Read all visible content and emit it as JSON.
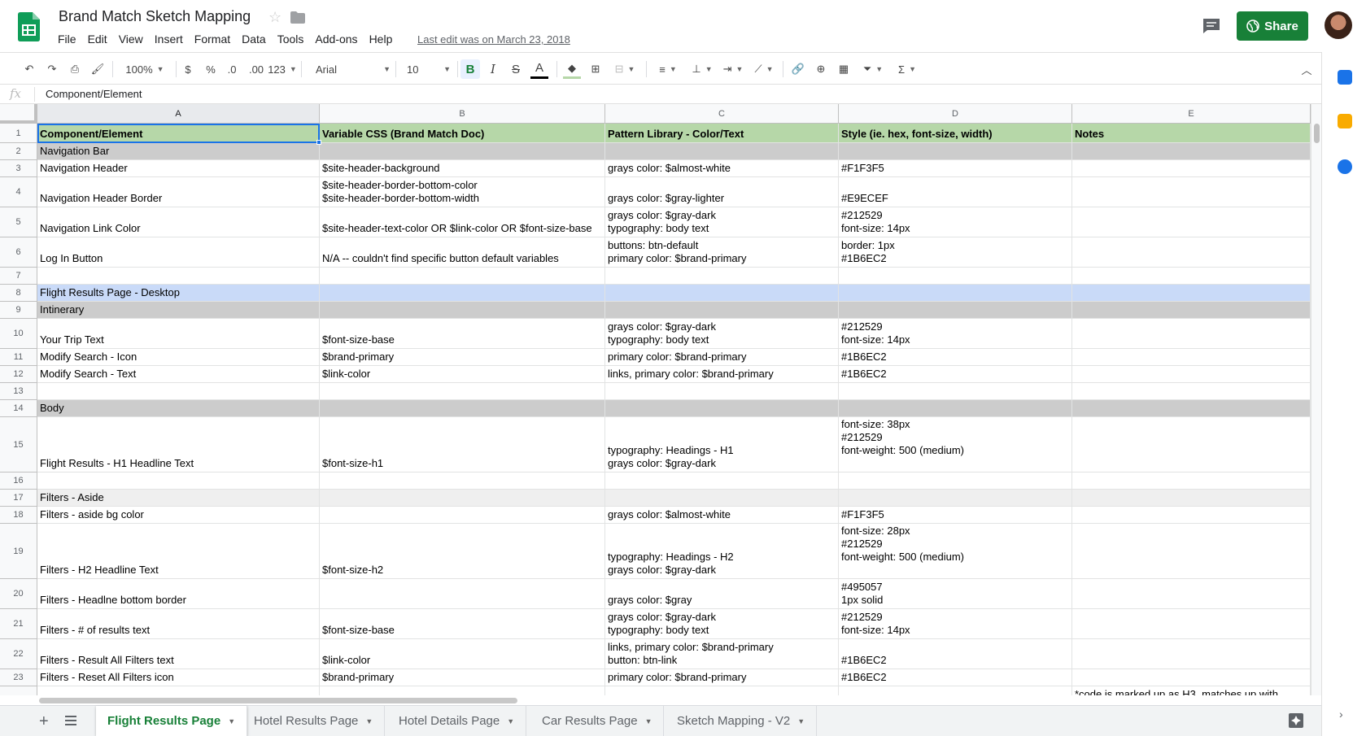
{
  "header": {
    "title": "Brand Match Sketch Mapping",
    "menus": [
      "File",
      "Edit",
      "View",
      "Insert",
      "Format",
      "Data",
      "Tools",
      "Add-ons",
      "Help"
    ],
    "last_edit": "Last edit was on March 23, 2018",
    "share_label": "Share"
  },
  "toolbar": {
    "zoom": "100%",
    "currency": "$",
    "percent": "%",
    "dec_decrease": ".0",
    "dec_increase": ".00",
    "more_formats": "123",
    "font": "Arial",
    "font_size": "10",
    "bold": "B",
    "italic": "I",
    "strike": "S",
    "text_color": "A",
    "function": "Σ"
  },
  "formula_bar": {
    "fx": "fx",
    "value": "Component/Element"
  },
  "columns": [
    "A",
    "B",
    "C",
    "D",
    "E"
  ],
  "rows": [
    {
      "num": "1",
      "style": "hdr",
      "cells": [
        [
          "Component/Element"
        ],
        [
          "Variable CSS (Brand Match Doc)"
        ],
        [
          "Pattern Library - Color/Text"
        ],
        [
          "Style (ie. hex, font-size, width)"
        ],
        [
          "Notes"
        ]
      ]
    },
    {
      "num": "2",
      "style": "gray",
      "cells": [
        [
          "Navigation Bar"
        ],
        [],
        [],
        [],
        []
      ]
    },
    {
      "num": "3",
      "style": "",
      "cells": [
        [
          "Navigation Header"
        ],
        [
          "$site-header-background"
        ],
        [
          "grays color: $almost-white"
        ],
        [
          "#F1F3F5"
        ],
        []
      ]
    },
    {
      "num": "4",
      "style": "",
      "cells": [
        [
          "Navigation Header Border"
        ],
        [
          "$site-header-border-bottom-color",
          "$site-header-border-bottom-width"
        ],
        [
          "grays color: $gray-lighter"
        ],
        [
          "#E9ECEF"
        ],
        []
      ]
    },
    {
      "num": "5",
      "style": "",
      "cells": [
        [
          "Navigation Link Color"
        ],
        [
          "$site-header-text-color OR $link-color OR $font-size-base"
        ],
        [
          "grays color: $gray-dark",
          "typography: body text"
        ],
        [
          "#212529",
          "font-size: 14px"
        ],
        []
      ]
    },
    {
      "num": "6",
      "style": "",
      "cells": [
        [
          "Log In Button"
        ],
        [
          "N/A -- couldn't find specific button default variables"
        ],
        [
          "buttons: btn-default",
          "primary color: $brand-primary"
        ],
        [
          "border: 1px",
          "#1B6EC2"
        ],
        []
      ]
    },
    {
      "num": "7",
      "style": "",
      "cells": [
        [],
        [],
        [],
        [],
        []
      ]
    },
    {
      "num": "8",
      "style": "blue",
      "cells": [
        [
          "Flight Results Page - Desktop"
        ],
        [],
        [],
        [],
        []
      ]
    },
    {
      "num": "9",
      "style": "gray",
      "cells": [
        [
          "Intinerary"
        ],
        [],
        [],
        [],
        []
      ]
    },
    {
      "num": "10",
      "style": "",
      "cells": [
        [
          "Your Trip Text"
        ],
        [
          "$font-size-base"
        ],
        [
          "grays color: $gray-dark",
          "typography: body text"
        ],
        [
          "#212529",
          "font-size: 14px"
        ],
        []
      ]
    },
    {
      "num": "11",
      "style": "",
      "cells": [
        [
          "Modify Search - Icon"
        ],
        [
          "$brand-primary"
        ],
        [
          "primary color: $brand-primary"
        ],
        [
          "#1B6EC2"
        ],
        []
      ]
    },
    {
      "num": "12",
      "style": "",
      "cells": [
        [
          "Modify Search - Text"
        ],
        [
          "$link-color"
        ],
        [
          "links, primary color: $brand-primary"
        ],
        [
          "#1B6EC2"
        ],
        []
      ]
    },
    {
      "num": "13",
      "style": "",
      "cells": [
        [],
        [],
        [],
        [],
        []
      ]
    },
    {
      "num": "14",
      "style": "gray",
      "cells": [
        [
          "Body"
        ],
        [],
        [],
        [],
        []
      ]
    },
    {
      "num": "15",
      "style": "",
      "cells": [
        [
          "Flight Results - H1 Headline Text"
        ],
        [
          "$font-size-h1"
        ],
        [
          "typography: Headings - H1",
          "grays color: $gray-dark"
        ],
        [
          "font-size: 38px",
          "#212529",
          "font-weight: 500 (medium)",
          ""
        ],
        []
      ]
    },
    {
      "num": "16",
      "style": "",
      "cells": [
        [],
        [],
        [],
        [],
        []
      ]
    },
    {
      "num": "17",
      "style": "lgray",
      "cells": [
        [
          "Filters - Aside"
        ],
        [],
        [],
        [],
        []
      ]
    },
    {
      "num": "18",
      "style": "",
      "cells": [
        [
          "Filters - aside bg color"
        ],
        [],
        [
          "grays color: $almost-white"
        ],
        [
          "#F1F3F5"
        ],
        []
      ]
    },
    {
      "num": "19",
      "style": "",
      "cells": [
        [
          "Filters - H2 Headline Text"
        ],
        [
          "$font-size-h2"
        ],
        [
          "typography: Headings - H2",
          "grays color: $gray-dark"
        ],
        [
          "font-size: 28px",
          "#212529",
          "font-weight: 500 (medium)",
          ""
        ],
        []
      ]
    },
    {
      "num": "20",
      "style": "",
      "cells": [
        [
          "Filters - Headlne bottom border"
        ],
        [],
        [
          "grays color: $gray"
        ],
        [
          "#495057",
          "1px solid"
        ],
        []
      ]
    },
    {
      "num": "21",
      "style": "",
      "cells": [
        [
          "Filters - # of results text"
        ],
        [
          "$font-size-base"
        ],
        [
          "grays color: $gray-dark",
          "typography: body text"
        ],
        [
          "#212529",
          "font-size: 14px"
        ],
        []
      ]
    },
    {
      "num": "22",
      "style": "",
      "cells": [
        [
          "Filters - Result All Filters text"
        ],
        [
          "$link-color"
        ],
        [
          "links, primary color: $brand-primary",
          "button: btn-link"
        ],
        [
          "#1B6EC2"
        ],
        []
      ]
    },
    {
      "num": "23",
      "style": "",
      "cells": [
        [
          "Filters - Reset All Filters icon"
        ],
        [
          "$brand-primary"
        ],
        [
          "primary color: $brand-primary"
        ],
        [
          "#1B6EC2"
        ],
        []
      ]
    },
    {
      "num": "",
      "style": "",
      "cells": [
        [],
        [],
        [],
        [],
        [
          "*code is marked up as H3, matches up with"
        ]
      ]
    }
  ],
  "sheet_tabs": [
    "Flight Results Page",
    "Hotel Results Page",
    "Hotel Details Page",
    "Car Results Page",
    "Sketch Mapping - V2"
  ],
  "active_tab": 0,
  "colors": {
    "header_row": "#b6d7a8",
    "section_gray": "#cccccc",
    "section_blue": "#c9daf8",
    "share_green": "#188038",
    "selection_blue": "#1a73e8"
  },
  "icons": {
    "logo": "google-sheets-logo-icon",
    "star": "star-icon",
    "folder": "folder-icon",
    "comment": "comment-icon",
    "share": "globe-icon",
    "undo": "undo-icon",
    "redo": "redo-icon",
    "print": "print-icon",
    "paint_format": "paint-format-icon"
  }
}
